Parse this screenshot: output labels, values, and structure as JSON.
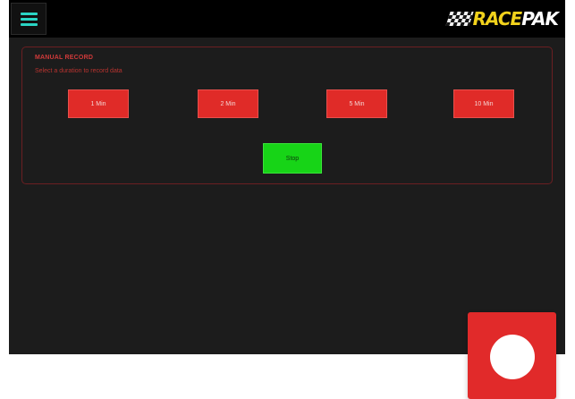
{
  "header": {
    "menu_icon": "hamburger-menu-icon",
    "logo_text_race": "RACE",
    "logo_text_pak": "PAK",
    "accent_color": "#2ad4c4"
  },
  "panel": {
    "title": "MANUAL RECORD",
    "description": "Select a duration to record data",
    "buttons": [
      {
        "label": "1 Min"
      },
      {
        "label": "2 Min"
      },
      {
        "label": "5 Min"
      },
      {
        "label": "10 Min"
      }
    ],
    "stop_label": "Stop",
    "button_color": "#e02b28",
    "stop_color": "#17d417"
  },
  "fab": {
    "icon": "record-icon",
    "color": "#e12a2a"
  }
}
